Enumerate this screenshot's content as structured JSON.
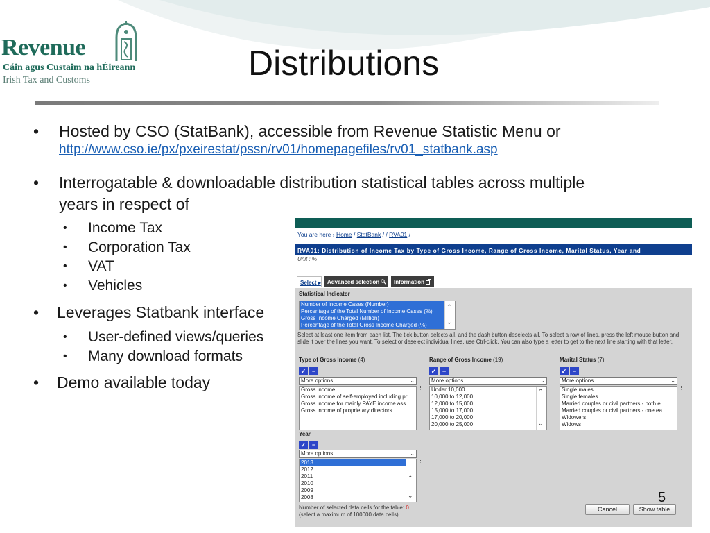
{
  "brand": {
    "name": "Revenue",
    "irish_line": "Cáin agus Custaim na hÉireann",
    "english_line": "Irish Tax and Customs"
  },
  "slide": {
    "title": "Distributions",
    "page_number": "5",
    "bullets": [
      {
        "text": "Hosted by CSO (StatBank), accessible from Revenue Statistic Menu or",
        "link": "http://www.cso.ie/px/pxeirestat/pssn/rv01/homepagefiles/rv01_statbank.asp"
      },
      {
        "text_line1": "Interrogatable & downloadable distribution statistical tables across multiple",
        "text_line2": "years in respect of",
        "subs": [
          "Income Tax",
          "Corporation Tax",
          "VAT",
          "Vehicles"
        ]
      },
      {
        "text": "Leverages Statbank interface",
        "subs": [
          "User-defined views/queries",
          "Many download formats"
        ]
      },
      {
        "text": "Demo available today"
      }
    ],
    "bullet_glyph": "•"
  },
  "statbank": {
    "breadcrumb": {
      "prefix": "You are here ›",
      "home": "Home",
      "statbank": "StatBank",
      "table": "RVA01",
      "sep": "/"
    },
    "table_title": "RVA01: Distribution of Income Tax by Type of Gross Income, Range of Gross Income, Marital Status, Year and",
    "unit": "Unit : %",
    "tabs": {
      "select": "Select",
      "advanced": "Advanced selection",
      "information": "Information"
    },
    "statistical_indicator": {
      "label": "Statistical Indicator",
      "items": [
        "Number of Income Cases (Number)",
        "Percentage of the Total Number of Income Cases (%)",
        "Gross Income Charged (Million)",
        "Percentage of the Total Gross Income Charged (%)"
      ]
    },
    "help_text": "Select at least one item from each list. The tick button selects all, and the dash button deselects all. To select a row of lines, press the left mouse button and slide it over the lines you want. To select or deselect individual lines, use Ctrl-click. You can also type a letter to get to the next line starting with that letter.",
    "variables": [
      {
        "label": "Type of Gross Income",
        "count": "(4)",
        "dropdown": "More options...",
        "items": [
          "Gross income",
          "Gross income of self-employed including pr",
          "Gross income for mainly PAYE income ass",
          "Gross income of proprietary directors"
        ]
      },
      {
        "label": "Range of Gross Income",
        "count": "(19)",
        "dropdown": "More options...",
        "items": [
          "Under 10,000",
          "10,000 to 12,000",
          "12,000 to 15,000",
          "15,000 to 17,000",
          "17,000 to 20,000",
          "20,000 to 25,000"
        ]
      },
      {
        "label": "Marital Status",
        "count": "(7)",
        "dropdown": "More options...",
        "items": [
          "Single males",
          "Single females",
          "Married couples or civil partners - both e",
          "Married couples or civil partners - one ea",
          "Widowers",
          "Widows"
        ]
      },
      {
        "label": "Year",
        "count": "",
        "dropdown": "More options...",
        "items": [
          "2013",
          "2012",
          "2011",
          "2010",
          "2009",
          "2008"
        ],
        "selected": "2013"
      }
    ],
    "selected_cells_label": "Number of selected data cells for the table:",
    "selected_cells_value": "0",
    "max_note": "(select a maximum of 100000 data cells)",
    "buttons": {
      "cancel": "Cancel",
      "show_table": "Show table"
    },
    "icons": {
      "check": "✓",
      "dash": "−",
      "arrow_up": "⌃",
      "arrow_down": "⌄",
      "caret": "⌄",
      "grip": "⋮",
      "play": "▸"
    }
  },
  "colors": {
    "brand_green": "#1f6b5a",
    "statbank_teal": "#0e5d55",
    "statbank_navy": "#0f3f8e",
    "link_blue": "#1a5fb4",
    "select_blue": "#2f6fd6"
  }
}
